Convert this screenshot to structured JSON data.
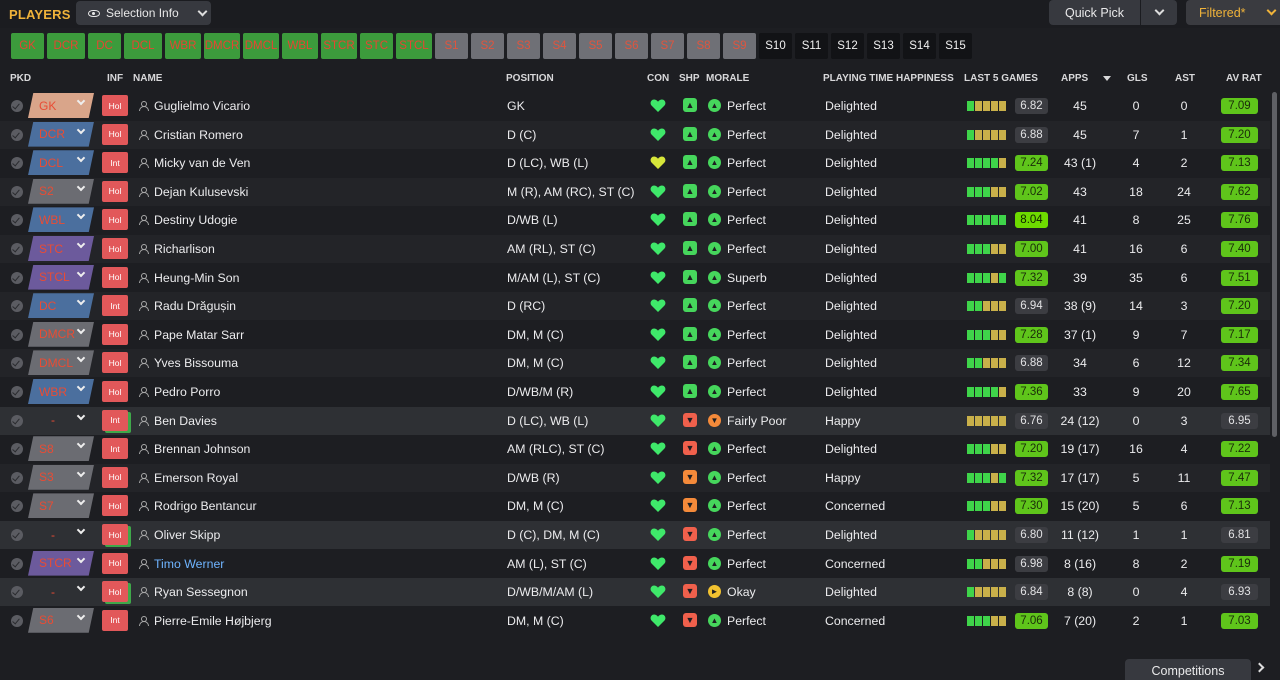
{
  "header": {
    "title": "PLAYERS",
    "selection_info": "Selection Info",
    "quick_pick": "Quick Pick",
    "filtered": "Filtered*"
  },
  "position_tabs": [
    {
      "label": "GK",
      "state": "green"
    },
    {
      "label": "DCR",
      "state": "green"
    },
    {
      "label": "DC",
      "state": "green"
    },
    {
      "label": "DCL",
      "state": "green"
    },
    {
      "label": "WBR",
      "state": "green"
    },
    {
      "label": "DMCR",
      "state": "green"
    },
    {
      "label": "DMCL",
      "state": "green"
    },
    {
      "label": "WBL",
      "state": "green"
    },
    {
      "label": "STCR",
      "state": "green"
    },
    {
      "label": "STC",
      "state": "green"
    },
    {
      "label": "STCL",
      "state": "green"
    },
    {
      "label": "S1",
      "state": "grey"
    },
    {
      "label": "S2",
      "state": "grey"
    },
    {
      "label": "S3",
      "state": "grey"
    },
    {
      "label": "S4",
      "state": "grey"
    },
    {
      "label": "S5",
      "state": "grey"
    },
    {
      "label": "S6",
      "state": "grey"
    },
    {
      "label": "S7",
      "state": "grey"
    },
    {
      "label": "S8",
      "state": "grey"
    },
    {
      "label": "S9",
      "state": "grey"
    },
    {
      "label": "S10",
      "state": "black"
    },
    {
      "label": "S11",
      "state": "black"
    },
    {
      "label": "S12",
      "state": "black"
    },
    {
      "label": "S13",
      "state": "black"
    },
    {
      "label": "S14",
      "state": "black"
    },
    {
      "label": "S15",
      "state": "black"
    }
  ],
  "columns": {
    "pkd": "PKD",
    "inf": "INF",
    "name": "NAME",
    "position": "POSITION",
    "con": "CON",
    "shp": "SHP",
    "morale": "MORALE",
    "playing_time": "PLAYING TIME HAPPINESS",
    "last5": "LAST 5 GAMES",
    "apps": "APPS",
    "gls": "GLS",
    "ast": "AST",
    "avrat": "AV RAT"
  },
  "players": [
    {
      "pkd": "GK",
      "pkd_style": "gk",
      "inf": "Hol",
      "name": "Guglielmo Vicario",
      "position": "GK",
      "con": "green",
      "shp": "green",
      "morale_icon": "green",
      "morale": "Perfect",
      "happiness": "Delighted",
      "bars": [
        "g",
        "y",
        "y",
        "y",
        "y"
      ],
      "last5": "6.82",
      "last5_style": "grey",
      "apps": "45",
      "gls": "0",
      "ast": "0",
      "avrat": "7.09",
      "avrat_style": "lime"
    },
    {
      "pkd": "DCR",
      "pkd_style": "blue",
      "inf": "Hol",
      "name": "Cristian Romero",
      "position": "D (C)",
      "con": "green",
      "shp": "green",
      "morale_icon": "green",
      "morale": "Perfect",
      "happiness": "Delighted",
      "bars": [
        "g",
        "y",
        "y",
        "y",
        "y"
      ],
      "last5": "6.88",
      "last5_style": "grey",
      "apps": "45",
      "gls": "7",
      "ast": "1",
      "avrat": "7.20",
      "avrat_style": "lime"
    },
    {
      "pkd": "DCL",
      "pkd_style": "blue",
      "inf": "Int",
      "name": "Micky van de Ven",
      "position": "D (LC), WB (L)",
      "con": "yellow",
      "shp": "green",
      "morale_icon": "green",
      "morale": "Perfect",
      "happiness": "Delighted",
      "bars": [
        "g",
        "g",
        "g",
        "g",
        "y"
      ],
      "last5": "7.24",
      "last5_style": "lime",
      "apps": "43 (1)",
      "gls": "4",
      "ast": "2",
      "avrat": "7.13",
      "avrat_style": "lime"
    },
    {
      "pkd": "S2",
      "pkd_style": "grey",
      "inf": "Hol",
      "name": "Dejan Kulusevski",
      "position": "M (R), AM (RC), ST (C)",
      "con": "green",
      "shp": "green",
      "morale_icon": "green",
      "morale": "Perfect",
      "happiness": "Delighted",
      "bars": [
        "g",
        "g",
        "g",
        "y",
        "y"
      ],
      "last5": "7.02",
      "last5_style": "lime",
      "apps": "43",
      "gls": "18",
      "ast": "24",
      "avrat": "7.62",
      "avrat_style": "lime"
    },
    {
      "pkd": "WBL",
      "pkd_style": "blue",
      "inf": "Hol",
      "name": "Destiny Udogie",
      "position": "D/WB (L)",
      "con": "green",
      "shp": "green",
      "morale_icon": "green",
      "morale": "Perfect",
      "happiness": "Delighted",
      "bars": [
        "g",
        "g",
        "g",
        "g",
        "g"
      ],
      "last5": "8.04",
      "last5_style": "bright",
      "apps": "41",
      "gls": "8",
      "ast": "25",
      "avrat": "7.76",
      "avrat_style": "lime"
    },
    {
      "pkd": "STC",
      "pkd_style": "purple",
      "inf": "Hol",
      "name": "Richarlison",
      "position": "AM (RL), ST (C)",
      "con": "green",
      "shp": "green",
      "morale_icon": "green",
      "morale": "Perfect",
      "happiness": "Delighted",
      "bars": [
        "g",
        "g",
        "g",
        "y",
        "y"
      ],
      "last5": "7.00",
      "last5_style": "lime",
      "apps": "41",
      "gls": "16",
      "ast": "6",
      "avrat": "7.40",
      "avrat_style": "lime"
    },
    {
      "pkd": "STCL",
      "pkd_style": "purple",
      "inf": "Hol",
      "name": "Heung-Min Son",
      "position": "M/AM (L), ST (C)",
      "con": "green",
      "shp": "green",
      "morale_icon": "green",
      "morale": "Superb",
      "happiness": "Delighted",
      "bars": [
        "g",
        "g",
        "g",
        "y",
        "g"
      ],
      "last5": "7.32",
      "last5_style": "lime",
      "apps": "39",
      "gls": "35",
      "ast": "6",
      "avrat": "7.51",
      "avrat_style": "lime"
    },
    {
      "pkd": "DC",
      "pkd_style": "blue",
      "inf": "Int",
      "name": "Radu Drăgușin",
      "position": "D (RC)",
      "con": "green",
      "shp": "green",
      "morale_icon": "green",
      "morale": "Perfect",
      "happiness": "Delighted",
      "bars": [
        "g",
        "g",
        "y",
        "y",
        "y"
      ],
      "last5": "6.94",
      "last5_style": "grey",
      "apps": "38 (9)",
      "gls": "14",
      "ast": "3",
      "avrat": "7.20",
      "avrat_style": "lime"
    },
    {
      "pkd": "DMCR",
      "pkd_style": "grey",
      "inf": "Hol",
      "name": "Pape Matar Sarr",
      "position": "DM, M (C)",
      "con": "green",
      "shp": "green",
      "morale_icon": "green",
      "morale": "Perfect",
      "happiness": "Delighted",
      "bars": [
        "g",
        "g",
        "g",
        "y",
        "y"
      ],
      "last5": "7.28",
      "last5_style": "lime",
      "apps": "37 (1)",
      "gls": "9",
      "ast": "7",
      "avrat": "7.17",
      "avrat_style": "lime"
    },
    {
      "pkd": "DMCL",
      "pkd_style": "grey",
      "inf": "Hol",
      "name": "Yves Bissouma",
      "position": "DM, M (C)",
      "con": "green",
      "shp": "green",
      "morale_icon": "green",
      "morale": "Perfect",
      "happiness": "Delighted",
      "bars": [
        "g",
        "g",
        "y",
        "y",
        "y"
      ],
      "last5": "6.88",
      "last5_style": "grey",
      "apps": "34",
      "gls": "6",
      "ast": "12",
      "avrat": "7.34",
      "avrat_style": "lime"
    },
    {
      "pkd": "WBR",
      "pkd_style": "blue",
      "inf": "Hol",
      "name": "Pedro Porro",
      "position": "D/WB/M (R)",
      "con": "green",
      "shp": "green",
      "morale_icon": "green",
      "morale": "Perfect",
      "happiness": "Delighted",
      "bars": [
        "g",
        "g",
        "g",
        "g",
        "y"
      ],
      "last5": "7.36",
      "last5_style": "lime",
      "apps": "33",
      "gls": "9",
      "ast": "20",
      "avrat": "7.65",
      "avrat_style": "lime"
    },
    {
      "pkd": "-",
      "pkd_style": "none",
      "inf": "Int",
      "name": "Ben Davies",
      "position": "D (LC), WB (L)",
      "con": "green",
      "shp": "red",
      "morale_icon": "orange",
      "morale": "Fairly Poor",
      "happiness": "Happy",
      "bars": [
        "y",
        "y",
        "y",
        "y",
        "y"
      ],
      "last5": "6.76",
      "last5_style": "grey",
      "apps": "24 (12)",
      "gls": "0",
      "ast": "3",
      "avrat": "6.95",
      "avrat_style": "grey",
      "row": "hl"
    },
    {
      "pkd": "S8",
      "pkd_style": "grey",
      "inf": "Int",
      "name": "Brennan Johnson",
      "position": "AM (RLC), ST (C)",
      "con": "green",
      "shp": "red",
      "morale_icon": "green",
      "morale": "Perfect",
      "happiness": "Delighted",
      "bars": [
        "g",
        "g",
        "g",
        "y",
        "y"
      ],
      "last5": "7.20",
      "last5_style": "lime",
      "apps": "19 (17)",
      "gls": "16",
      "ast": "4",
      "avrat": "7.22",
      "avrat_style": "lime"
    },
    {
      "pkd": "S3",
      "pkd_style": "grey",
      "inf": "Hol",
      "name": "Emerson Royal",
      "position": "D/WB (R)",
      "con": "green",
      "shp": "orange",
      "morale_icon": "green",
      "morale": "Perfect",
      "happiness": "Happy",
      "bars": [
        "g",
        "g",
        "g",
        "y",
        "g"
      ],
      "last5": "7.32",
      "last5_style": "lime",
      "apps": "17 (17)",
      "gls": "5",
      "ast": "11",
      "avrat": "7.47",
      "avrat_style": "lime"
    },
    {
      "pkd": "S7",
      "pkd_style": "grey",
      "inf": "Hol",
      "name": "Rodrigo Bentancur",
      "position": "DM, M (C)",
      "con": "green",
      "shp": "orange",
      "morale_icon": "green",
      "morale": "Perfect",
      "happiness": "Concerned",
      "bars": [
        "g",
        "g",
        "g",
        "y",
        "y"
      ],
      "last5": "7.30",
      "last5_style": "lime",
      "apps": "15 (20)",
      "gls": "5",
      "ast": "6",
      "avrat": "7.13",
      "avrat_style": "lime"
    },
    {
      "pkd": "-",
      "pkd_style": "none",
      "inf": "Hol",
      "name": "Oliver Skipp",
      "position": "D (C), DM, M (C)",
      "con": "green",
      "shp": "red",
      "morale_icon": "green",
      "morale": "Perfect",
      "happiness": "Delighted",
      "bars": [
        "g",
        "y",
        "y",
        "y",
        "y"
      ],
      "last5": "6.80",
      "last5_style": "grey",
      "apps": "11 (12)",
      "gls": "1",
      "ast": "1",
      "avrat": "6.81",
      "avrat_style": "grey",
      "row": "hl"
    },
    {
      "pkd": "STCR",
      "pkd_style": "purple",
      "inf": "Hol",
      "name": "Timo Werner",
      "name_style": "blue",
      "position": "AM (L), ST (C)",
      "con": "green",
      "shp": "red",
      "morale_icon": "green",
      "morale": "Perfect",
      "happiness": "Concerned",
      "bars": [
        "g",
        "g",
        "y",
        "y",
        "y"
      ],
      "last5": "6.98",
      "last5_style": "grey",
      "apps": "8 (16)",
      "gls": "8",
      "ast": "2",
      "avrat": "7.19",
      "avrat_style": "lime"
    },
    {
      "pkd": "-",
      "pkd_style": "none",
      "inf": "Hol",
      "name": "Ryan Sessegnon",
      "position": "D/WB/M/AM (L)",
      "con": "green",
      "shp": "red",
      "morale_icon": "yellow",
      "morale": "Okay",
      "happiness": "Delighted",
      "bars": [
        "g",
        "y",
        "y",
        "y",
        "y"
      ],
      "last5": "6.84",
      "last5_style": "grey",
      "apps": "8 (8)",
      "gls": "0",
      "ast": "4",
      "avrat": "6.93",
      "avrat_style": "grey",
      "row": "hl"
    },
    {
      "pkd": "S6",
      "pkd_style": "grey",
      "inf": "Int",
      "name": "Pierre-Emile Højbjerg",
      "position": "DM, M (C)",
      "con": "green",
      "shp": "red",
      "morale_icon": "green",
      "morale": "Perfect",
      "happiness": "Concerned",
      "bars": [
        "g",
        "g",
        "g",
        "y",
        "y"
      ],
      "last5": "7.06",
      "last5_style": "lime",
      "apps": "7 (20)",
      "gls": "2",
      "ast": "1",
      "avrat": "7.03",
      "avrat_style": "lime"
    }
  ],
  "footer": {
    "competitions": "Competitions"
  },
  "colors": {
    "accent": "#f0b33a",
    "green_badge": "#5fc51b",
    "red_tag": "#e94c34"
  }
}
